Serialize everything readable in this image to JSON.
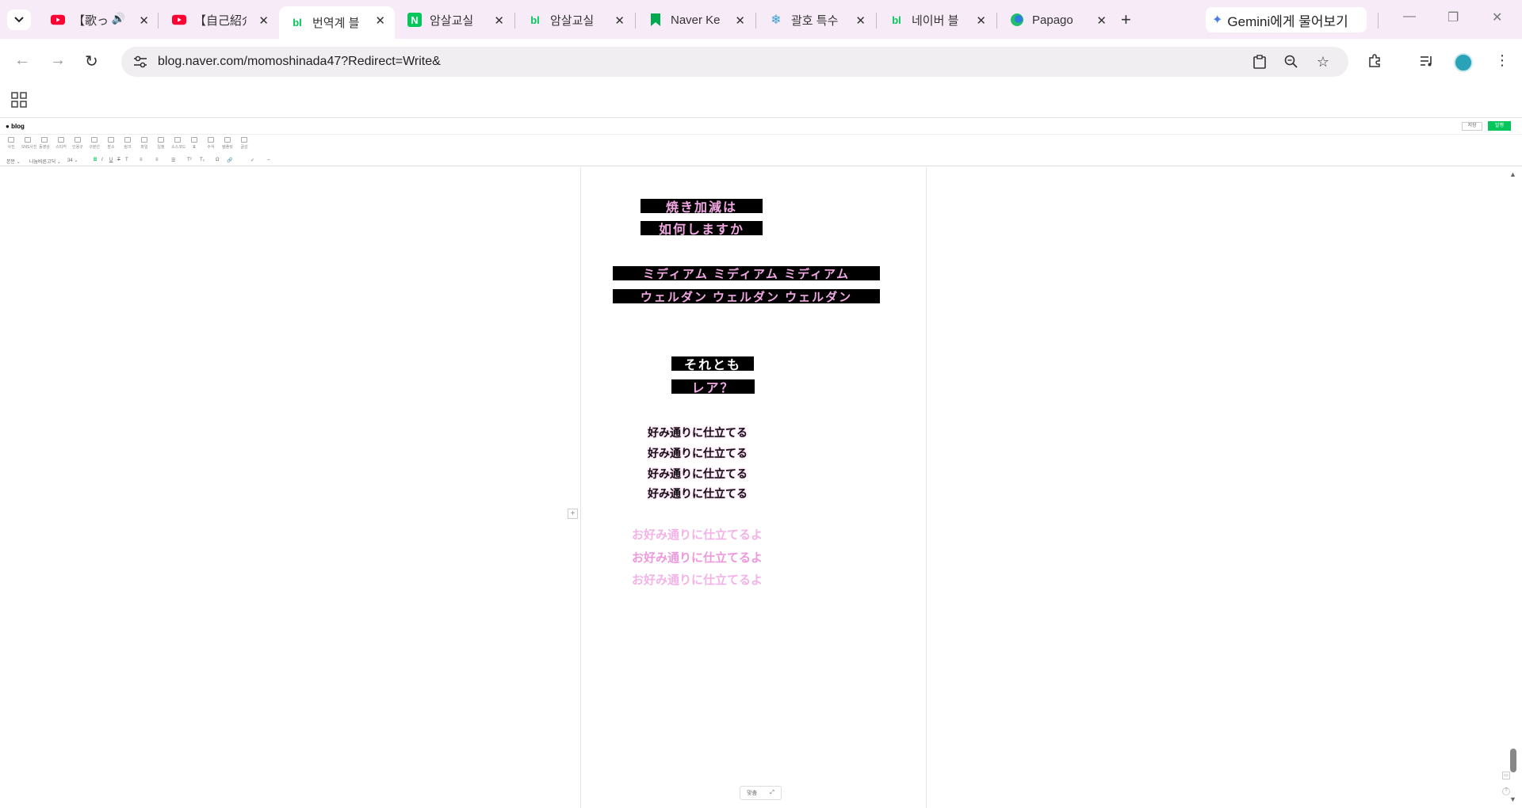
{
  "browser": {
    "tabs": [
      {
        "title": "【歌っ",
        "favicon": "youtube-icon",
        "playing_audio": true
      },
      {
        "title": "【自己紹介",
        "favicon": "youtube-icon"
      },
      {
        "title": "번역계 블",
        "favicon": "naver-blog-icon",
        "active": true
      },
      {
        "title": "암살교실",
        "favicon": "naver-n-icon"
      },
      {
        "title": "암살교실",
        "favicon": "naver-blog-icon"
      },
      {
        "title": "Naver Ke",
        "favicon": "bookmark-icon"
      },
      {
        "title": "괄호 특수",
        "favicon": "snowflake-icon"
      },
      {
        "title": "네이버 블",
        "favicon": "naver-blog-icon"
      },
      {
        "title": "Papago",
        "favicon": "papago-icon"
      }
    ],
    "gemini_label": "Gemini에게 물어보기",
    "url": "blog.naver.com/momoshinada47?Redirect=Write&",
    "colors": {
      "tabstrip": "#f8ebf8",
      "naver_green": "#03c75a",
      "youtube_red": "#ff0033"
    }
  },
  "editor": {
    "logo": "blog",
    "save_label": "저장",
    "publish_label": "발행",
    "toolbar_items": [
      "사진",
      "SNS사진",
      "동영상",
      "스티커",
      "인용구",
      "구분선",
      "장소",
      "링크",
      "파일",
      "일정",
      "소스코드",
      "표",
      "수식",
      "템플릿",
      "글감"
    ],
    "format": {
      "style": "본문",
      "font": "나눔바른고딕",
      "size": "34"
    },
    "bottom_widget": "맞춤"
  },
  "content": {
    "strips": [
      {
        "text": "焼き加減は",
        "color": "pink"
      },
      {
        "text": "如何しますか",
        "color": "pink"
      },
      {
        "text": "ミディアム ミディアム ミディアム",
        "color": "pink"
      },
      {
        "text": "ウェルダン ウェルダン ウェルダン",
        "color": "pink"
      },
      {
        "text": "それとも",
        "color": "white"
      },
      {
        "text": "レア？",
        "color": "pink"
      }
    ],
    "black_lines": [
      "好み通りに仕立てる",
      "好み通りに仕立てる",
      "好み通りに仕立てる",
      "好み通りに仕立てる"
    ],
    "pink_lines": [
      "お好み通りに仕立てるよ",
      "お好み通りに仕立てるよ",
      "お好み通りに仕立てるよ"
    ]
  }
}
